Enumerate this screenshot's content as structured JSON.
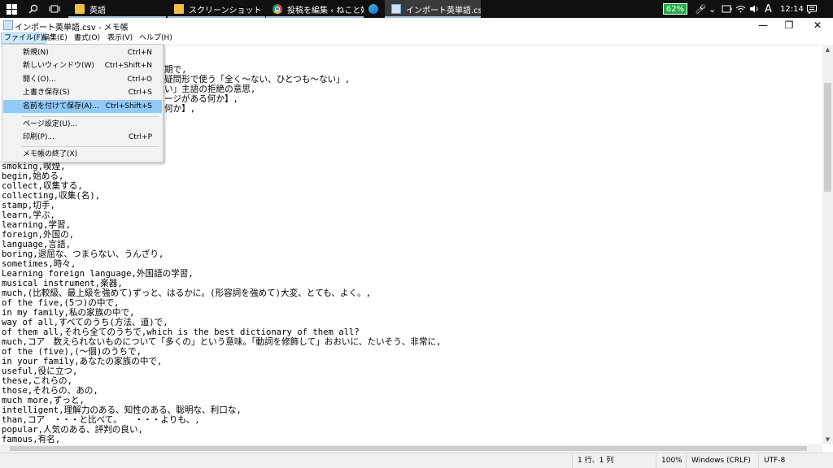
{
  "taskbar": {
    "apps": [
      {
        "label": "英語",
        "icon": "folder-icon"
      },
      {
        "label": "スクリーンショット",
        "icon": "folder-icon"
      },
      {
        "label": "投稿を編集 ‹ ねこと姫 ...",
        "icon": "chrome-icon"
      },
      {
        "label": "",
        "icon": "edge-icon"
      },
      {
        "label": "インポート英単語.csv - ...",
        "icon": "notepad-icon"
      }
    ],
    "battery": "62%",
    "ime": "A",
    "time": "12:14"
  },
  "window": {
    "title": "インポート英単語.csv - メモ帳",
    "minimize": "—",
    "maximize": "❐",
    "close": "✕"
  },
  "menubar": [
    "ファイル(F)",
    "編集(E)",
    "書式(O)",
    "表示(V)",
    "ヘルプ(H)"
  ],
  "file_menu": [
    {
      "label": "新規(N)",
      "shortcut": "Ctrl+N"
    },
    {
      "label": "新しいウィンドウ(W)",
      "shortcut": "Ctrl+Shift+N"
    },
    {
      "label": "開く(O)...",
      "shortcut": "Ctrl+O"
    },
    {
      "label": "上書き保存(S)",
      "shortcut": "Ctrl+S"
    },
    {
      "label": "名前を付けて保存(A)...",
      "shortcut": "Ctrl+Shift+S"
    },
    {
      "label": "ページ設定(U)...",
      "shortcut": ""
    },
    {
      "label": "印刷(P)...",
      "shortcut": "Ctrl+P"
    },
    {
      "label": "メモ帳の終了(X)",
      "shortcut": ""
    }
  ],
  "editor": {
    "fragments": [
      "期で,",
      "疑問形で使う「全く～ない、ひとつも～ない」,",
      "い」主語の拒絶の意思,",
      "ージがある何か】,",
      "何か】,"
    ],
    "lines": [
      "smoking,喫煙,",
      "begin,始める,",
      "collect,収集する,",
      "collecting,収集(名),",
      "stamp,切手,",
      "learn,学ぶ,",
      "learning,学習,",
      "foreign,外国の,",
      "language,言語,",
      "boring,退屈な、つまらない、うんざり,",
      "sometimes,時々,",
      "Learning foreign language,外国語の学習,",
      "musical instrument,楽器,",
      "much,(比較級、最上級を強めて)ずっと、はるかに。(形容詞を強めて)大変、とても、よく。,",
      "of the five,(5つ)の中で,",
      "in my family,私の家族の中で,",
      "way of all,すべてのうち(方法、道)で,",
      "of them all,それら全てのうちで,which is the best dictionary of them all?",
      "much,コア　数えられないものについて「多くの」という意味。「動詞を修飾して」おおいに、たいそう、非常に,",
      "of the (five),(～個)のうちで,",
      "in your family,あなたの家族の中で,",
      "useful,役に立つ,",
      "these,これらの,",
      "those,それらの、あの,",
      "much more,ずっと,",
      "intelligent,理解力のある、知性のある、聡明な、利口な,",
      "than,コア　・・・と比べて。　　・・・よりも、,",
      "popular,人気のある、評判の良い,",
      "famous,有名,"
    ]
  },
  "statusbar": {
    "position": "1 行、1 列",
    "zoom": "100%",
    "line_ending": "Windows (CRLF)",
    "encoding": "UTF-8"
  }
}
